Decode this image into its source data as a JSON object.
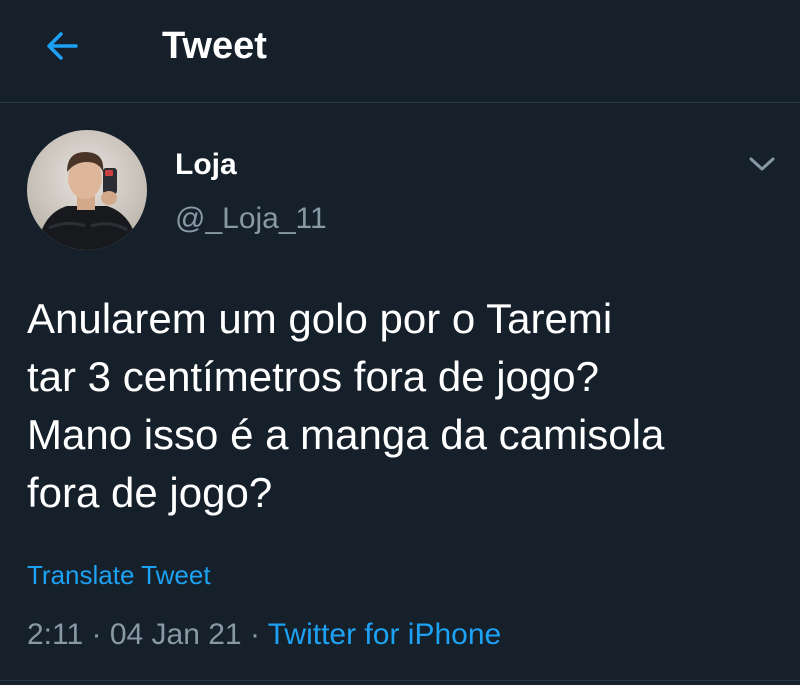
{
  "header": {
    "title": "Tweet",
    "back_icon": "arrow-left-icon"
  },
  "author": {
    "name": "Loja",
    "handle": "@_Loja_11",
    "avatar": "user-avatar-photo"
  },
  "tweet": {
    "lines": [
      "Anularem um golo por o Taremi",
      "tar 3 centímetros fora de jogo?",
      "Mano isso é a manga da camisola",
      "fora de jogo?"
    ]
  },
  "translate_label": "Translate Tweet",
  "meta": {
    "time": "2:11",
    "separator": " · ",
    "date": "04 Jan 21",
    "source": "Twitter for iPhone"
  },
  "colors": {
    "background": "#15202b",
    "accent": "#1da1f2",
    "secondary_text": "#8899a6",
    "divider": "#2b3743"
  }
}
